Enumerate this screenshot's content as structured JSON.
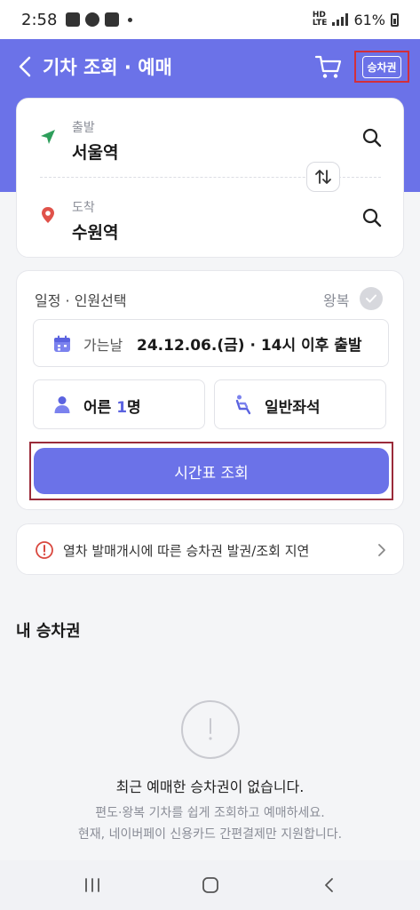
{
  "status_bar": {
    "time": "2:58",
    "network_top": "HD",
    "network_sub": "LTE",
    "battery": "61%"
  },
  "header": {
    "title": "기차 조회 · 예매",
    "ticket_label": "승차권",
    "icons": [
      "chevron-left-icon",
      "cart-icon"
    ]
  },
  "stations": {
    "departure_label": "출발",
    "departure_name": "서울역",
    "arrival_label": "도착",
    "arrival_name": "수원역"
  },
  "schedule": {
    "heading": "일정 · 인원선택",
    "round_trip_label": "왕복",
    "date_label": "가는날",
    "date_value": "24.12.06.(금) · 14시 이후 출발",
    "adult_prefix": "어른 ",
    "adult_count": "1",
    "adult_suffix": "명",
    "seat_type": "일반좌석"
  },
  "search_button": "시간표 조회",
  "notice": "열차 발매개시에 따른 승차권 발권/조회 지연",
  "my_tickets": {
    "title": "내 승차권",
    "empty_title": "최근 예매한 승차권이 없습니다.",
    "empty_sub1": "편도·왕복 기차를 쉽게 조회하고 예매하세요.",
    "empty_sub2": "현재, 네이버페이 신용카드 간편결제만 지원합니다."
  },
  "colors": {
    "accent": "#6b72e8",
    "departure_pin": "#2e9e5b",
    "arrival_pin": "#e0524a",
    "highlight_box": "#d32f3a"
  }
}
